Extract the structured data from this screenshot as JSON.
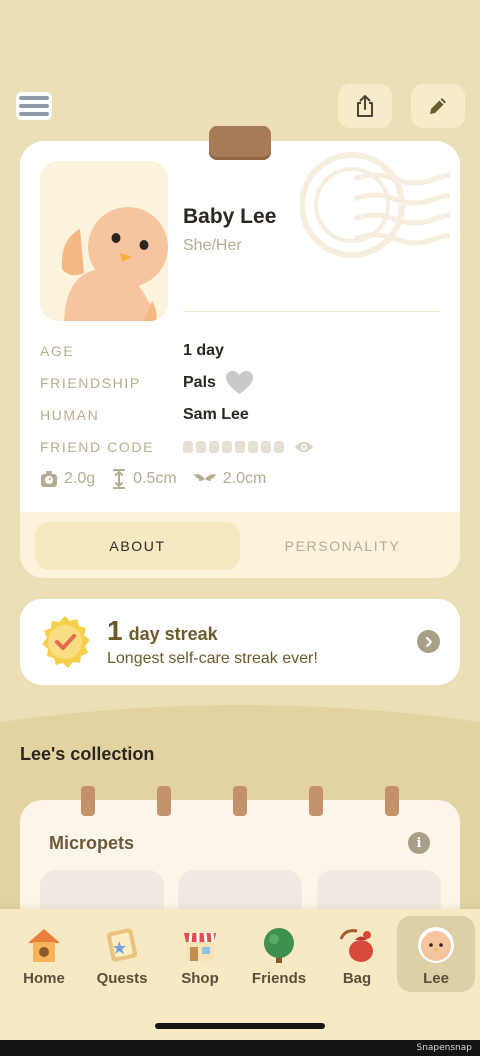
{
  "profile": {
    "name": "Baby Lee",
    "pronouns": "She/Her",
    "rows": [
      {
        "label": "AGE",
        "value": "1 day"
      },
      {
        "label": "FRIENDSHIP",
        "value": "Pals"
      },
      {
        "label": "HUMAN",
        "value": "Sam Lee"
      },
      {
        "label": "FRIEND CODE",
        "value": ""
      }
    ],
    "stats": {
      "weight": "2.0g",
      "height": "0.5cm",
      "wingspan": "2.0cm"
    },
    "tabs": {
      "about": "ABOUT",
      "personality": "PERSONALITY"
    }
  },
  "streak": {
    "count": "1",
    "label": "day streak",
    "subtitle": "Longest self-care streak ever!"
  },
  "collection": {
    "title": "Lee's collection",
    "section_title": "Micropets"
  },
  "nav": {
    "items": [
      {
        "label": "Home",
        "icon": "birdhouse-icon"
      },
      {
        "label": "Quests",
        "icon": "quest-scroll-icon"
      },
      {
        "label": "Shop",
        "icon": "shop-icon"
      },
      {
        "label": "Friends",
        "icon": "tree-icon"
      },
      {
        "label": "Bag",
        "icon": "bag-icon"
      },
      {
        "label": "Lee",
        "icon": "bird-face-icon"
      }
    ],
    "active": "Lee"
  },
  "watermark": "Snapensnap",
  "colors": {
    "background": "#ebdfb6",
    "card": "#ffffff",
    "accent_brown": "#a77b57",
    "streak_text": "#6b5a2b"
  }
}
